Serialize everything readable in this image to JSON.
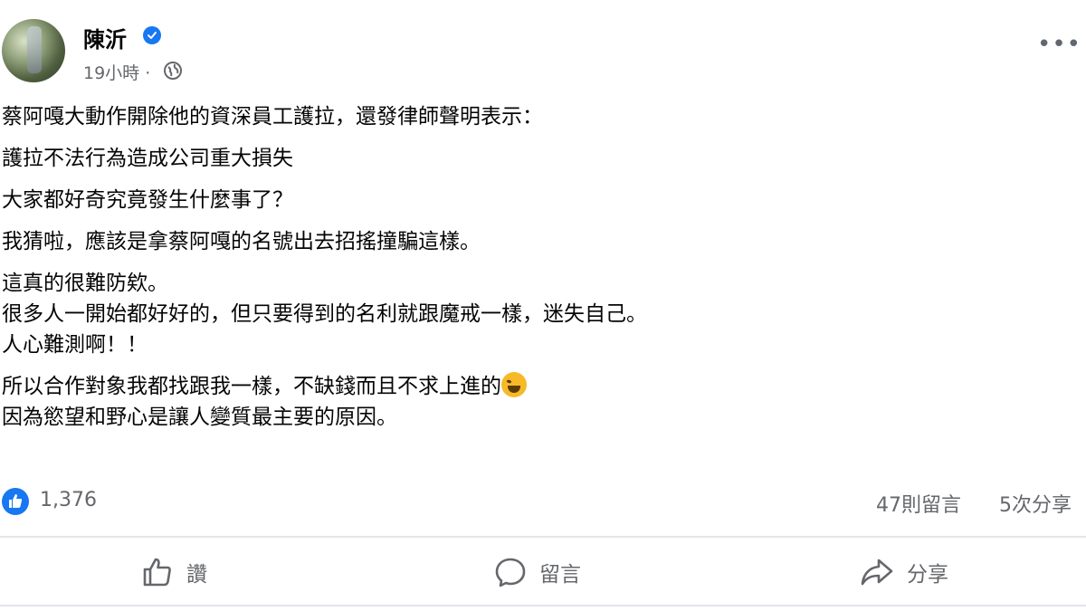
{
  "post": {
    "author": "陳沂",
    "meta": "19小時 ·",
    "body": {
      "p1": "蔡阿嘎大動作開除他的資深員工護拉，還發律師聲明表示：",
      "p2": "護拉不法行為造成公司重大損失",
      "p3": "大家都好奇究竟發生什麼事了？",
      "p4": "我猜啦，應該是拿蔡阿嘎的名號出去招搖撞騙這樣。",
      "p5a": "這真的很難防欸。",
      "p5b": "很多人一開始都好好的，但只要得到的名利就跟魔戒一樣，迷失自己。",
      "p5c": "人心難測啊！！",
      "p6a": "所以合作對象我都找跟我一樣，不缺錢而且不求上進的",
      "p6b": "因為慾望和野心是讓人變質最主要的原因。"
    },
    "emoji_icon": "rolling-laughing-emoji"
  },
  "stats": {
    "likes": "1,376",
    "comments": "47則留言",
    "shares": "5次分享"
  },
  "actions": {
    "like": "讚",
    "comment": "留言",
    "share": "分享"
  },
  "colors": {
    "accent": "#1877f2",
    "secondary_text": "#65676b",
    "divider": "#e4e6eb"
  }
}
